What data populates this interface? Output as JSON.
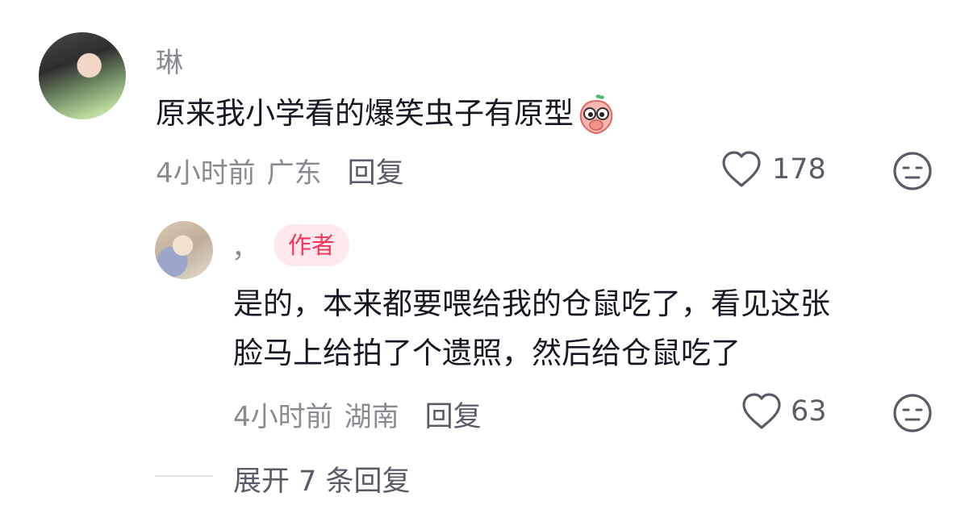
{
  "comment": {
    "username": "琳",
    "text": "原来我小学看的爆笑虫子有原型",
    "time": "4小时前",
    "location": "广东",
    "reply_label": "回复",
    "like_count": "178",
    "emoji_icon": "peach-face-covering-mouth"
  },
  "reply": {
    "username": "，",
    "badge": "作者",
    "text_line1": "是的，本来都要喂给我的仓鼠吃了，看见这张",
    "text_line2": "脸马上给拍了个遗照，然后给仓鼠吃了",
    "time": "4小时前",
    "location": "湖南",
    "reply_label": "回复",
    "like_count": "63"
  },
  "expand": {
    "label": "展开 7 条回复"
  },
  "colors": {
    "badge_text": "#f3345b",
    "badge_bg": "#fde8ec",
    "meta": "#8a8b91"
  }
}
